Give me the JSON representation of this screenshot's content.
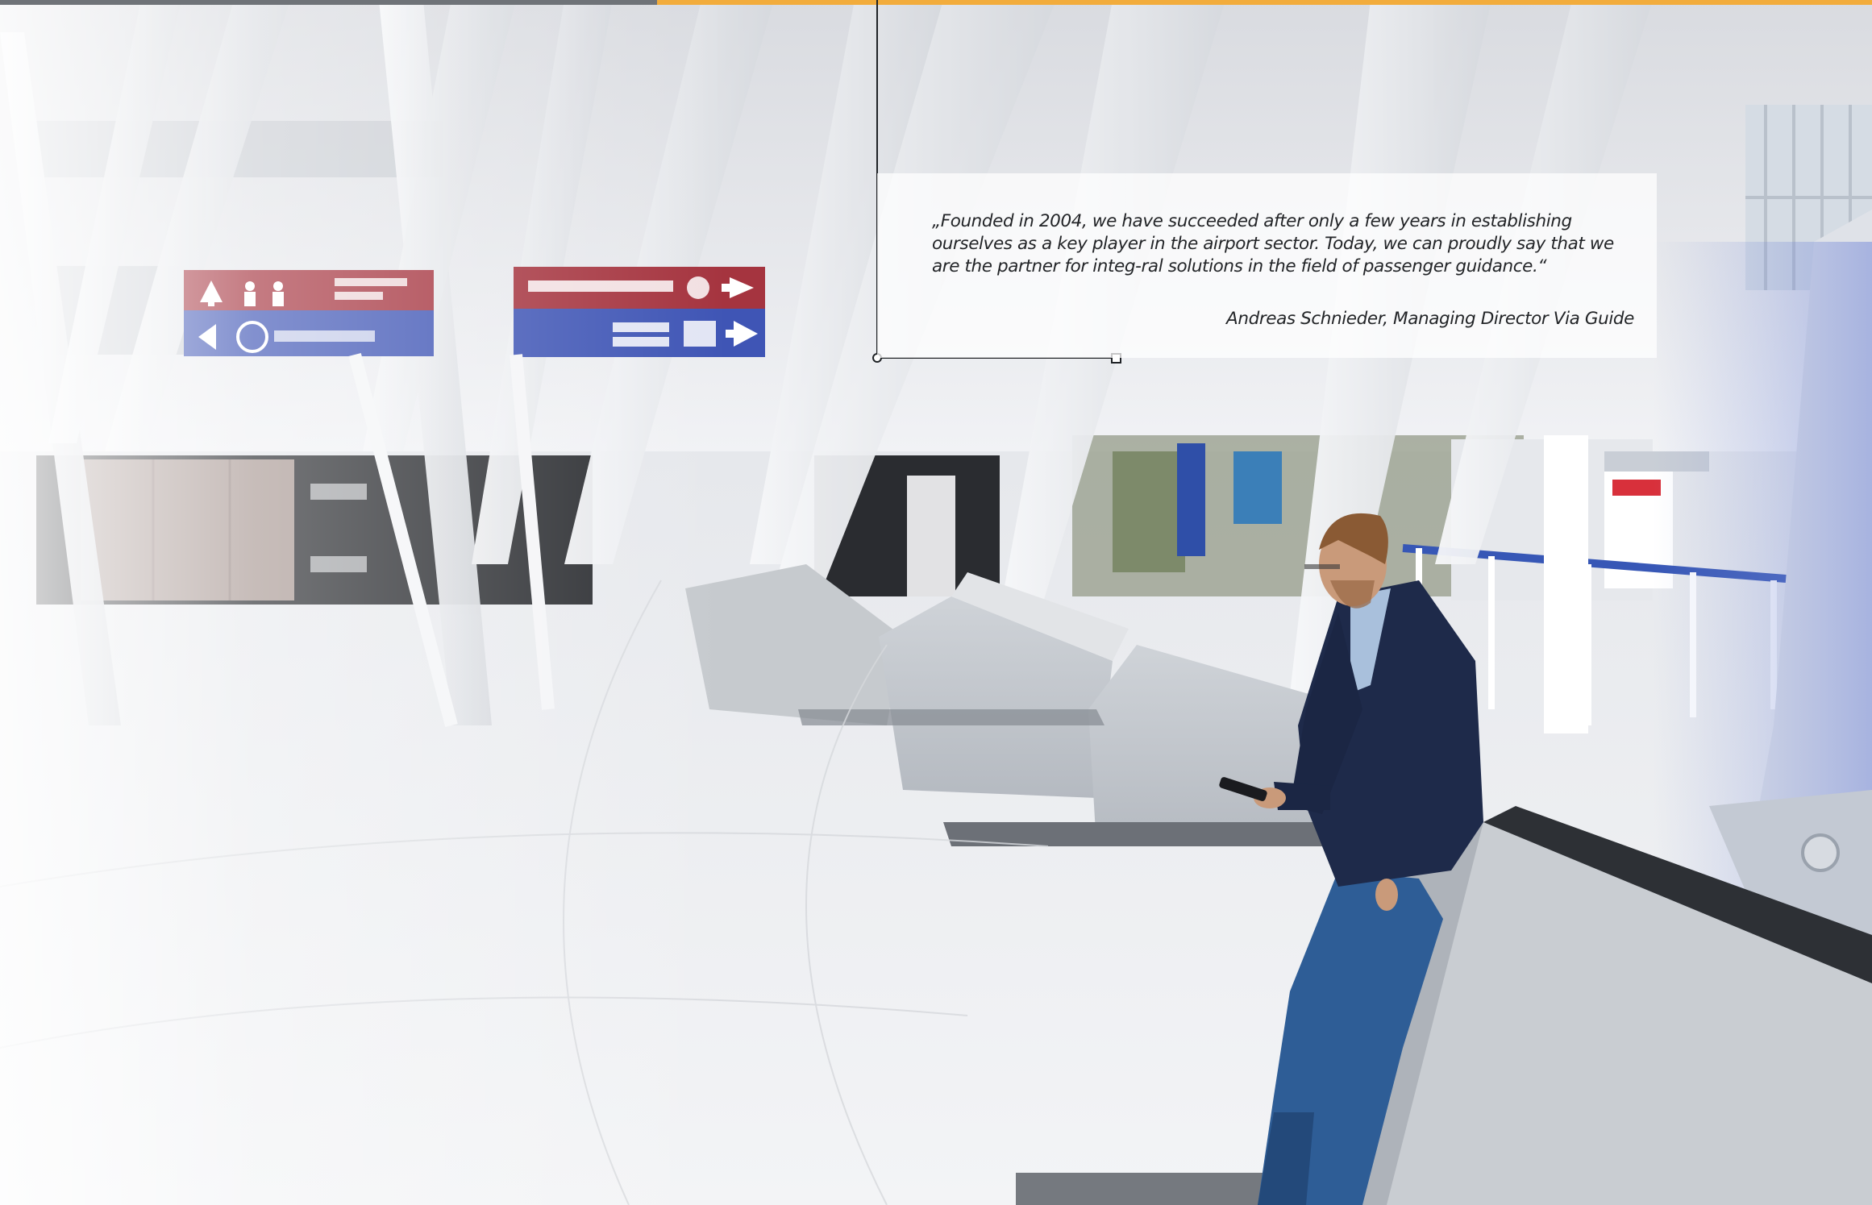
{
  "quote": {
    "text": "„Founded in 2004, we have succeeded after only a few years in establishing ourselves as a key player in the airport sector. Today, we can proudly say that we are the partner for integ-ral solutions in the field of passenger guidance.“",
    "author": "Andreas Schnieder, Managing Director Via Guide"
  },
  "colors": {
    "accent_orange": "#f2ac3c",
    "bar_gray": "#6f7378",
    "sign_red": "#a5343f",
    "sign_blue": "#3f55b5",
    "suit_navy": "#1e2a4a",
    "jeans_blue": "#2e5d96"
  },
  "icons": [
    "arrow-up-icon",
    "arrow-left-icon",
    "arrow-right-icon",
    "restroom-icon",
    "info-icon",
    "shop-icon",
    "baggage-icon"
  ]
}
